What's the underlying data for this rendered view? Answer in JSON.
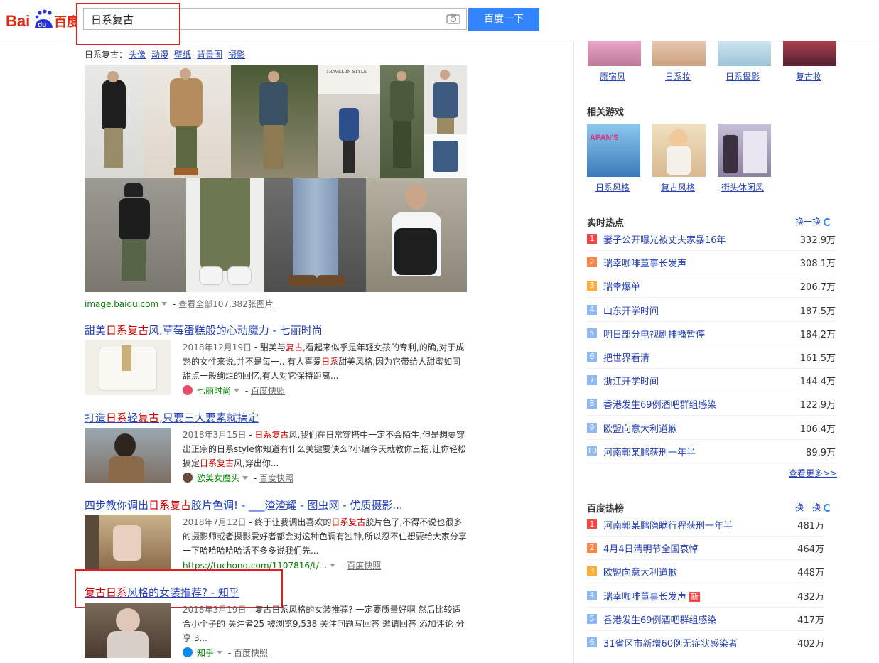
{
  "colors": {
    "accent": "#3385ff",
    "link": "#2440b3",
    "highlight": "#c00000",
    "annotation_box": "#e02020",
    "rank_top": "#f54545",
    "rank_2": "#ff8547",
    "rank_3": "#ffac38",
    "rank_rest": "#8eb9f5"
  },
  "search": {
    "query": "日系复古",
    "button_label": "百度一下",
    "logo_text": "百度"
  },
  "image_block": {
    "prefix": "日系复古：",
    "categories": [
      "头像",
      "动漫",
      "壁纸",
      "背景图",
      "摄影"
    ],
    "source": "image.baidu.com",
    "view_all": "查看全部107,382张图片"
  },
  "results": [
    {
      "title_parts": [
        "甜美",
        "日系复古",
        "风,草莓蛋糕般的心动魔力 - 七丽时尚"
      ],
      "date": "2018年12月19日",
      "abstract_parts": [
        " - 甜美与",
        "复古",
        ",看起来似乎是年轻女孩的专利,的确,对于成熟的女性来说,并不是每一...有人喜爱",
        "日系",
        "甜美风格,因为它带给人甜蜜如同甜点一般绚烂的回忆,有人对它保持距离..."
      ],
      "source": "七丽时尚",
      "snapshot": "百度快照"
    },
    {
      "title_parts": [
        "打造",
        "日系",
        "轻",
        "复古",
        ",只要三大要素就搞定"
      ],
      "date": "2018年3月15日",
      "abstract_parts": [
        " - ",
        "日系复古",
        "风,我们在日常穿搭中一定不会陌生,但是想要穿出正宗的日系style你知道有什么关键要诀么?小编今天就教你三招,让你轻松搞定",
        "日系复古",
        "风,穿出你..."
      ],
      "source": "欧美女魔头",
      "snapshot": "百度快照"
    },
    {
      "title_parts": [
        "四步教你调出",
        "日系复古",
        "胶片色调! - ___渣渣耀 - 图虫网 - 优质摄影..."
      ],
      "date": "2018年7月12日",
      "abstract_parts": [
        " - 终于让我调出喜欢的",
        "日系复古",
        "胶片色了,不得不说也很多的摄影师或者摄影爱好者都会对这种色调有独钟,所以忍不住想要给大家分享一下哈哈哈哈哈话不多多说我们先..."
      ],
      "source": "https://tuchong.com/1107816/t/...",
      "snapshot": "百度快照"
    },
    {
      "title_parts": [
        "复古",
        "日系",
        "风格的女装推荐? - 知乎"
      ],
      "date": "2018年3月19日",
      "abstract_parts": [
        " - 复古日系风格的女装推荐? 一定要质量好啊 然后比较适合小个子的 关注者25 被浏览9,538 关注问题写回答 邀请回答 添加评论 分享 3..."
      ],
      "source": "知乎",
      "snapshot": "百度快照"
    }
  ],
  "sidebar": {
    "related_styles": [
      "原宿风",
      "日系妆",
      "日系摄影",
      "复古妆"
    ],
    "games_title": "相关游戏",
    "games": [
      "日系风格",
      "复古风格",
      "街头休闲风"
    ],
    "realtime_title": "实时热点",
    "refresh_label": "换一换",
    "realtime": [
      {
        "rank": "1",
        "text": "妻子公开曝光被丈夫家暴16年",
        "value": "332.9万"
      },
      {
        "rank": "2",
        "text": "瑞幸咖啡董事长发声",
        "value": "308.1万"
      },
      {
        "rank": "3",
        "text": "瑞幸爆单",
        "value": "206.7万"
      },
      {
        "rank": "4",
        "text": "山东开学时间",
        "value": "187.5万"
      },
      {
        "rank": "5",
        "text": "明日部分电视剧排播暂停",
        "value": "184.2万"
      },
      {
        "rank": "6",
        "text": "把世界看清",
        "value": "161.5万"
      },
      {
        "rank": "7",
        "text": "浙江开学时间",
        "value": "144.4万"
      },
      {
        "rank": "8",
        "text": "香港发生69例酒吧群组感染",
        "value": "122.9万"
      },
      {
        "rank": "9",
        "text": "欧盟向意大利道歉",
        "value": "106.4万"
      },
      {
        "rank": "10",
        "text": "河南郭某鹏获刑一年半",
        "value": "89.9万"
      }
    ],
    "more_label": "查看更多>>",
    "baidu_hot_title": "百度热榜",
    "baidu_hot": [
      {
        "rank": "1",
        "text": "河南郭某鹏隐瞒行程获刑一年半",
        "value": "481万",
        "badge": ""
      },
      {
        "rank": "2",
        "text": "4月4日清明节全国哀悼",
        "value": "464万",
        "badge": ""
      },
      {
        "rank": "3",
        "text": "欧盟向意大利道歉",
        "value": "448万",
        "badge": ""
      },
      {
        "rank": "4",
        "text": "瑞幸咖啡董事长发声",
        "value": "432万",
        "badge": "新"
      },
      {
        "rank": "5",
        "text": "香港发生69例酒吧群组感染",
        "value": "417万",
        "badge": ""
      },
      {
        "rank": "6",
        "text": "31省区市新增60例无症状感染者",
        "value": "402万",
        "badge": ""
      }
    ]
  }
}
